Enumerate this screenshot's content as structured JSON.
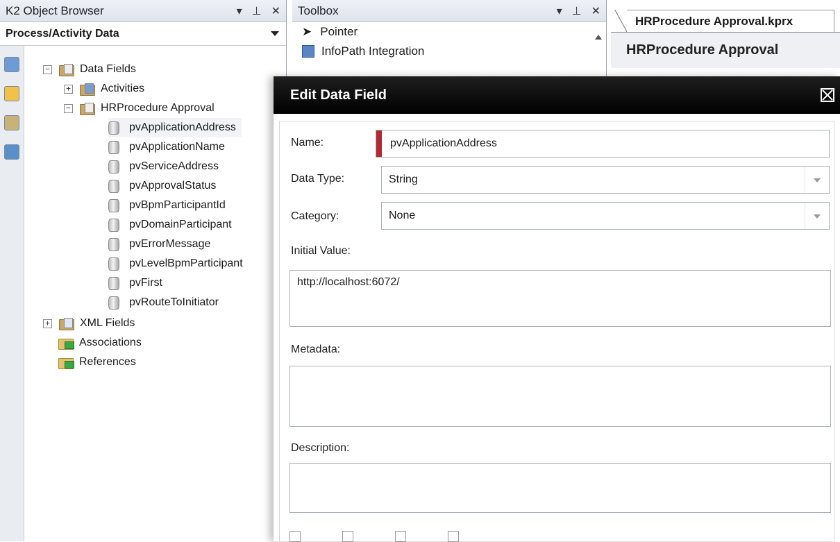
{
  "object_browser": {
    "title": "K2 Object Browser",
    "view_selector": "Process/Activity Data",
    "tree": {
      "data_fields": "Data Fields",
      "activities": "Activities",
      "process": "HRProcedure Approval",
      "fields": [
        "pvApplicationAddress",
        "pvApplicationName",
        "pvServiceAddress",
        "pvApprovalStatus",
        "pvBpmParticipantId",
        "pvDomainParticipant",
        "pvErrorMessage",
        "pvLevelBpmParticipant",
        "pvFirst",
        "pvRouteToInitiator"
      ],
      "xml_fields": "XML Fields",
      "associations": "Associations",
      "references": "References"
    }
  },
  "toolbox": {
    "title": "Toolbox",
    "items": [
      "Pointer",
      "InfoPath Integration"
    ]
  },
  "designer": {
    "tab": "HRProcedure Approval.kprx",
    "heading": "HRProcedure Approval"
  },
  "dialog": {
    "title": "Edit Data Field",
    "name_label": "Name:",
    "name_value": "pvApplicationAddress",
    "data_type_label": "Data Type:",
    "data_type_value": "String",
    "category_label": "Category:",
    "category_value": "None",
    "initial_value_label": "Initial Value:",
    "initial_value": "http://localhost:6072/",
    "metadata_label": "Metadata:",
    "metadata_value": "",
    "description_label": "Description:",
    "description_value": ""
  },
  "colors": {
    "accent_required": "#b02a30",
    "dialog_title_bg": "#000000"
  }
}
